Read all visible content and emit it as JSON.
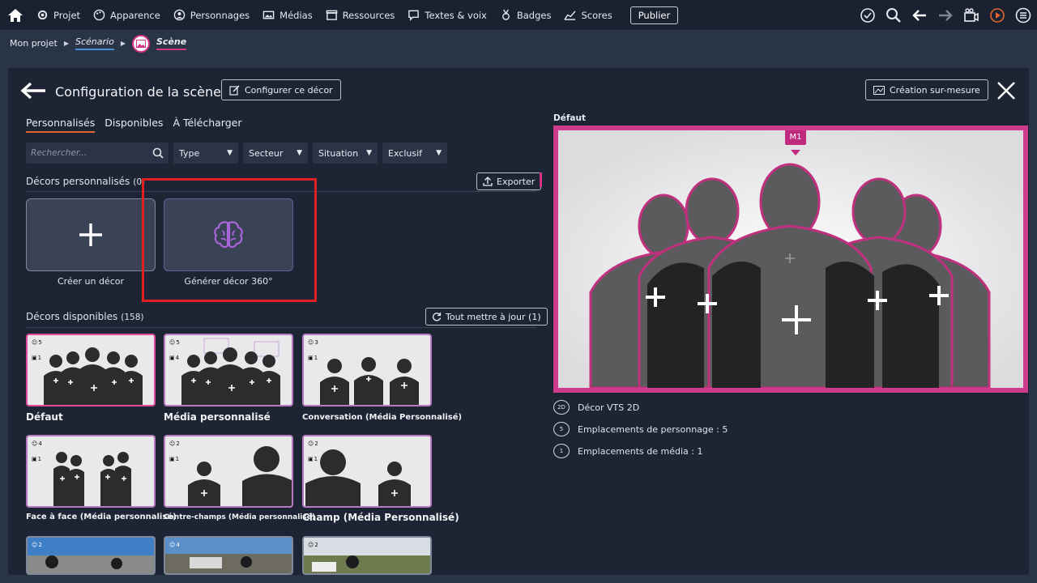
{
  "menu": [
    {
      "label": "Projet",
      "icon": "gear-icon"
    },
    {
      "label": "Apparence",
      "icon": "palette-icon"
    },
    {
      "label": "Personnages",
      "icon": "person-icon"
    },
    {
      "label": "Médias",
      "icon": "media-icon"
    },
    {
      "label": "Ressources",
      "icon": "box-icon"
    },
    {
      "label": "Textes & voix",
      "icon": "speech-icon"
    },
    {
      "label": "Badges",
      "icon": "badge-icon"
    },
    {
      "label": "Scores",
      "icon": "chart-icon"
    }
  ],
  "publish_label": "Publier",
  "breadcrumb": {
    "project": "Mon projet",
    "scenario": "Scénario",
    "scene": "Scène"
  },
  "panel": {
    "title": "Configuration de la scène",
    "configure_button": "Configurer ce décor",
    "custom_button": "Création sur-mesure"
  },
  "tabs": [
    "Personnalisés",
    "Disponibles",
    "À Télécharger"
  ],
  "search_placeholder": "Rechercher...",
  "filters": [
    "Type",
    "Secteur",
    "Situation",
    "Exclusif"
  ],
  "custom_section": {
    "title": "Décors personnalisés",
    "count": "(0)",
    "export_label": "Exporter"
  },
  "create_card": {
    "label": "Créer un décor"
  },
  "generate_card": {
    "label": "Générer décor 360°"
  },
  "available_section": {
    "title": "Décors disponibles",
    "count": "(158)",
    "update_label": "Tout mettre à jour (1)"
  },
  "thumbnails": [
    {
      "label": "Défaut",
      "chars": "5",
      "media": "1"
    },
    {
      "label": "Média personnalisé",
      "chars": "5",
      "media": "4"
    },
    {
      "label": "Conversation (Média Personnalisé)",
      "chars": "3",
      "media": "1"
    },
    {
      "label": "Face à face (Média personnalisé)",
      "chars": "4",
      "media": "1"
    },
    {
      "label": "Contre-champs (Média personnalisé)",
      "chars": "2",
      "media": "1"
    },
    {
      "label": "Champ (Média Personnalisé)",
      "chars": "2",
      "media": "1"
    },
    {
      "label": "",
      "chars": "2",
      "media": ""
    },
    {
      "label": "",
      "chars": "4",
      "media": ""
    },
    {
      "label": "",
      "chars": "2",
      "media": ""
    }
  ],
  "preview": {
    "label": "Défaut",
    "marker": "M1",
    "info": [
      {
        "icon": "2D",
        "text": "Décor VTS 2D"
      },
      {
        "icon": "5",
        "text": "Emplacements de personnage : 5"
      },
      {
        "icon": "1",
        "text": "Emplacements de média : 1"
      }
    ]
  },
  "colors": {
    "accent": "#d63384",
    "tab_underline": "#e0662d",
    "highlight": "#e02020"
  }
}
